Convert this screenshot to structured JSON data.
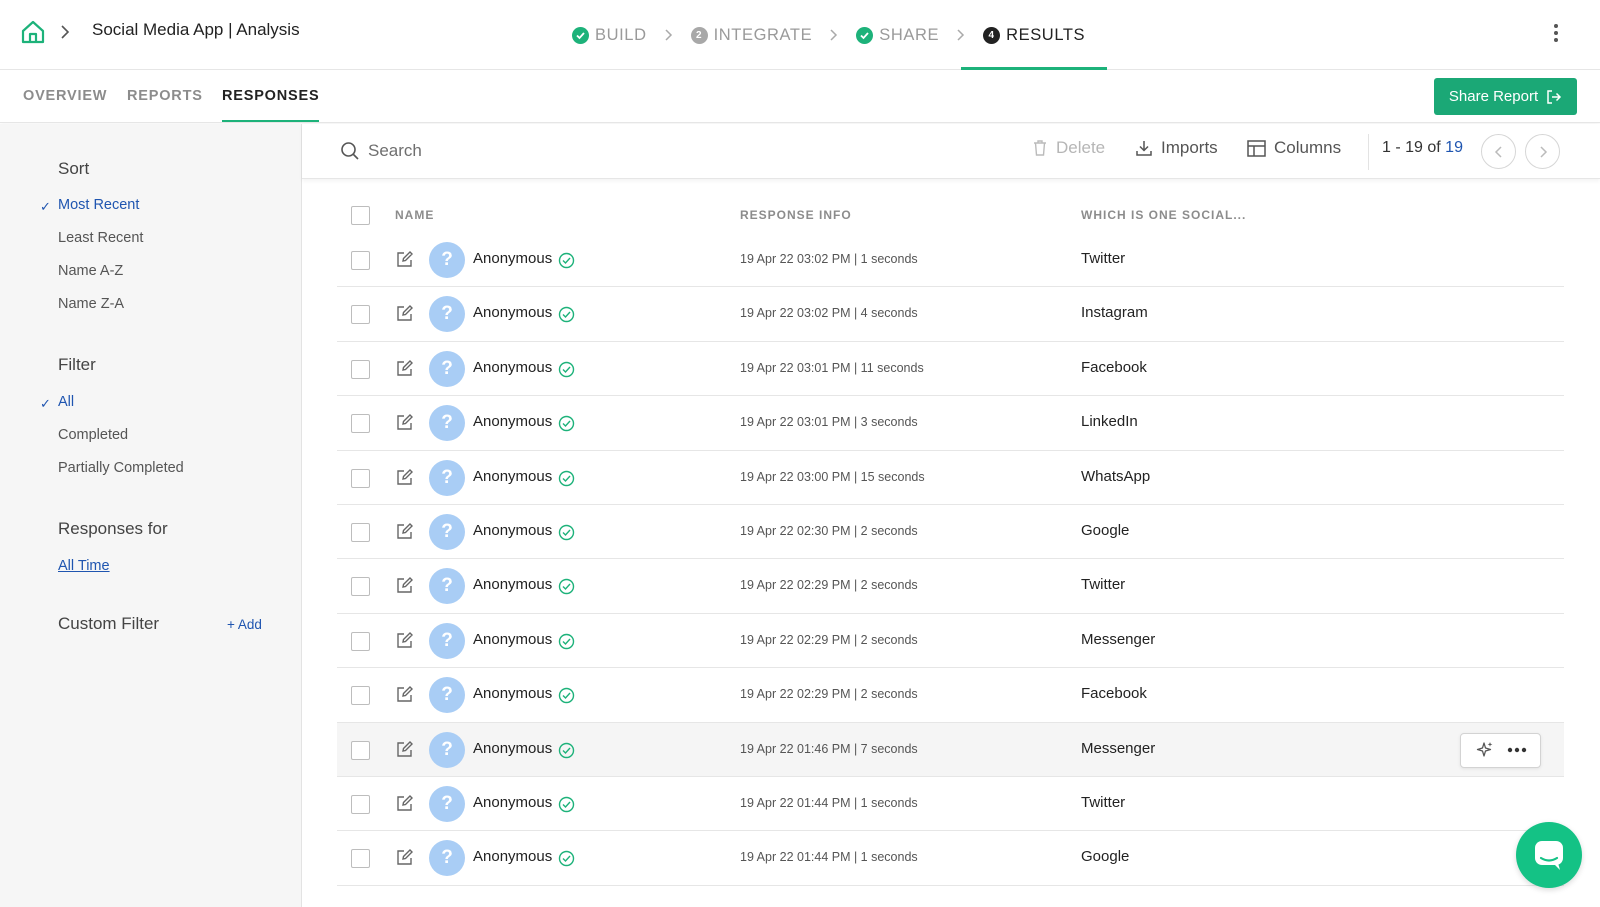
{
  "header": {
    "title": "Social Media App | Analysis",
    "steps": [
      {
        "label": "BUILD",
        "badge": "",
        "state": "done"
      },
      {
        "label": "INTEGRATE",
        "badge": "2",
        "state": "pending"
      },
      {
        "label": "SHARE",
        "badge": "",
        "state": "done"
      },
      {
        "label": "RESULTS",
        "badge": "4",
        "state": "current"
      }
    ]
  },
  "subnav": {
    "tabs": [
      {
        "label": "OVERVIEW",
        "active": false
      },
      {
        "label": "REPORTS",
        "active": false
      },
      {
        "label": "RESPONSES",
        "active": true
      }
    ],
    "share_label": "Share Report"
  },
  "sidebar": {
    "sort_heading": "Sort",
    "sort_options": [
      {
        "label": "Most Recent",
        "selected": true
      },
      {
        "label": "Least Recent",
        "selected": false
      },
      {
        "label": "Name A-Z",
        "selected": false
      },
      {
        "label": "Name Z-A",
        "selected": false
      }
    ],
    "filter_heading": "Filter",
    "filter_options": [
      {
        "label": "All",
        "selected": true
      },
      {
        "label": "Completed",
        "selected": false
      },
      {
        "label": "Partially Completed",
        "selected": false
      }
    ],
    "responses_for_heading": "Responses for",
    "time_range": "All Time",
    "custom_filter_heading": "Custom Filter",
    "add_label": "Add"
  },
  "toolbar": {
    "search_placeholder": "Search",
    "delete_label": "Delete",
    "imports_label": "Imports",
    "columns_label": "Columns",
    "range": "1 - 19",
    "of_label": "of",
    "total": "19"
  },
  "table": {
    "columns": [
      "NAME",
      "RESPONSE INFO",
      "WHICH IS ONE SOCIAL..."
    ],
    "rows": [
      {
        "name": "Anonymous",
        "info": "19 Apr 22 03:02 PM | 1 seconds",
        "answer": "Twitter"
      },
      {
        "name": "Anonymous",
        "info": "19 Apr 22 03:02 PM | 4 seconds",
        "answer": "Instagram"
      },
      {
        "name": "Anonymous",
        "info": "19 Apr 22 03:01 PM | 11 seconds",
        "answer": "Facebook"
      },
      {
        "name": "Anonymous",
        "info": "19 Apr 22 03:01 PM | 3 seconds",
        "answer": "LinkedIn"
      },
      {
        "name": "Anonymous",
        "info": "19 Apr 22 03:00 PM | 15 seconds",
        "answer": "WhatsApp"
      },
      {
        "name": "Anonymous",
        "info": "19 Apr 22 02:30 PM | 2 seconds",
        "answer": "Google"
      },
      {
        "name": "Anonymous",
        "info": "19 Apr 22 02:29 PM | 2 seconds",
        "answer": "Twitter"
      },
      {
        "name": "Anonymous",
        "info": "19 Apr 22 02:29 PM | 2 seconds",
        "answer": "Messenger"
      },
      {
        "name": "Anonymous",
        "info": "19 Apr 22 02:29 PM | 2 seconds",
        "answer": "Facebook"
      },
      {
        "name": "Anonymous",
        "info": "19 Apr 22 01:46 PM | 7 seconds",
        "answer": "Messenger",
        "hovered": true
      },
      {
        "name": "Anonymous",
        "info": "19 Apr 22 01:44 PM | 1 seconds",
        "answer": "Twitter"
      },
      {
        "name": "Anonymous",
        "info": "19 Apr 22 01:44 PM | 1 seconds",
        "answer": "Google"
      }
    ]
  },
  "icons": {
    "home": "home-icon",
    "step_done": "check-circle-icon",
    "edit": "edit-icon",
    "avatar": "question-mark-icon",
    "completed": "check-circle-outline-icon",
    "chat": "chat-icon"
  },
  "colors": {
    "accent": "#1db27a",
    "button": "#1ba876",
    "link": "#1f55b0",
    "avatar": "#a9cdf5",
    "chat": "#14c285"
  }
}
